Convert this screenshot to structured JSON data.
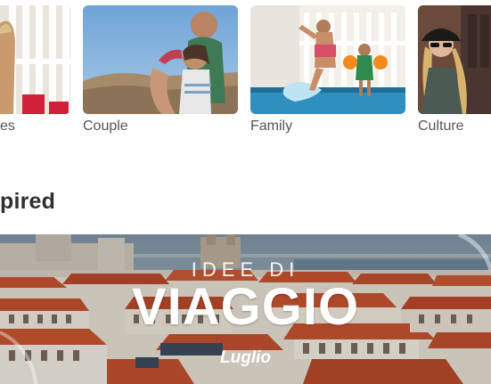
{
  "categories": [
    {
      "label": "es"
    },
    {
      "label": "Couple"
    },
    {
      "label": "Family"
    },
    {
      "label": "Culture"
    }
  ],
  "section": {
    "heading": "pired"
  },
  "banner": {
    "kicker": "IDEE DI",
    "title": "VIAGGIO",
    "subtitle": "Luglio"
  },
  "colors": {
    "label_text": "#555555",
    "heading_text": "#2f2f2f",
    "roof_tile": "#c5532f",
    "sky": "#8fa3b3"
  }
}
